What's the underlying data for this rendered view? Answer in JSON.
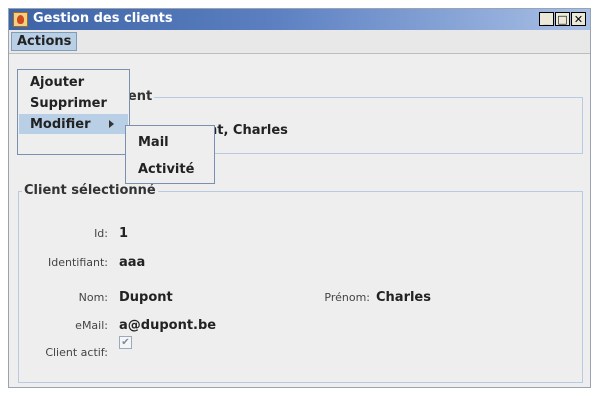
{
  "window": {
    "title": "Gestion des clients",
    "app_icon": "java-cup-icon",
    "controls": [
      "minimize-icon",
      "maximize-icon",
      "close-icon"
    ]
  },
  "menubar": {
    "actions_label": "Actions"
  },
  "actions_menu": {
    "items": [
      "Ajouter",
      "Supprimer",
      "Modifier"
    ],
    "highlighted": "Modifier"
  },
  "modifier_submenu": {
    "items": [
      "Mail",
      "Activité"
    ]
  },
  "client_group": {
    "title_visible": "lient",
    "selected_client_visible": "nt, Charles"
  },
  "selected_client": {
    "title": "Client sélectionné",
    "fields": {
      "id_label": "Id:",
      "id_value": "1",
      "identifiant_label": "Identifiant:",
      "identifiant_value": "aaa",
      "nom_label": "Nom:",
      "nom_value": "Dupont",
      "prenom_label": "Prénom:",
      "prenom_value": "Charles",
      "email_label": "eMail:",
      "email_value": "a@dupont.be",
      "actif_label": "Client actif:",
      "actif_checked": true
    }
  },
  "colors": {
    "titlebar_start": "#3d64a6",
    "titlebar_end": "#a9c0e6",
    "menu_highlight": "#b8cfe5",
    "panel_bg": "#eeeeee",
    "group_border": "#b9cbe0"
  }
}
